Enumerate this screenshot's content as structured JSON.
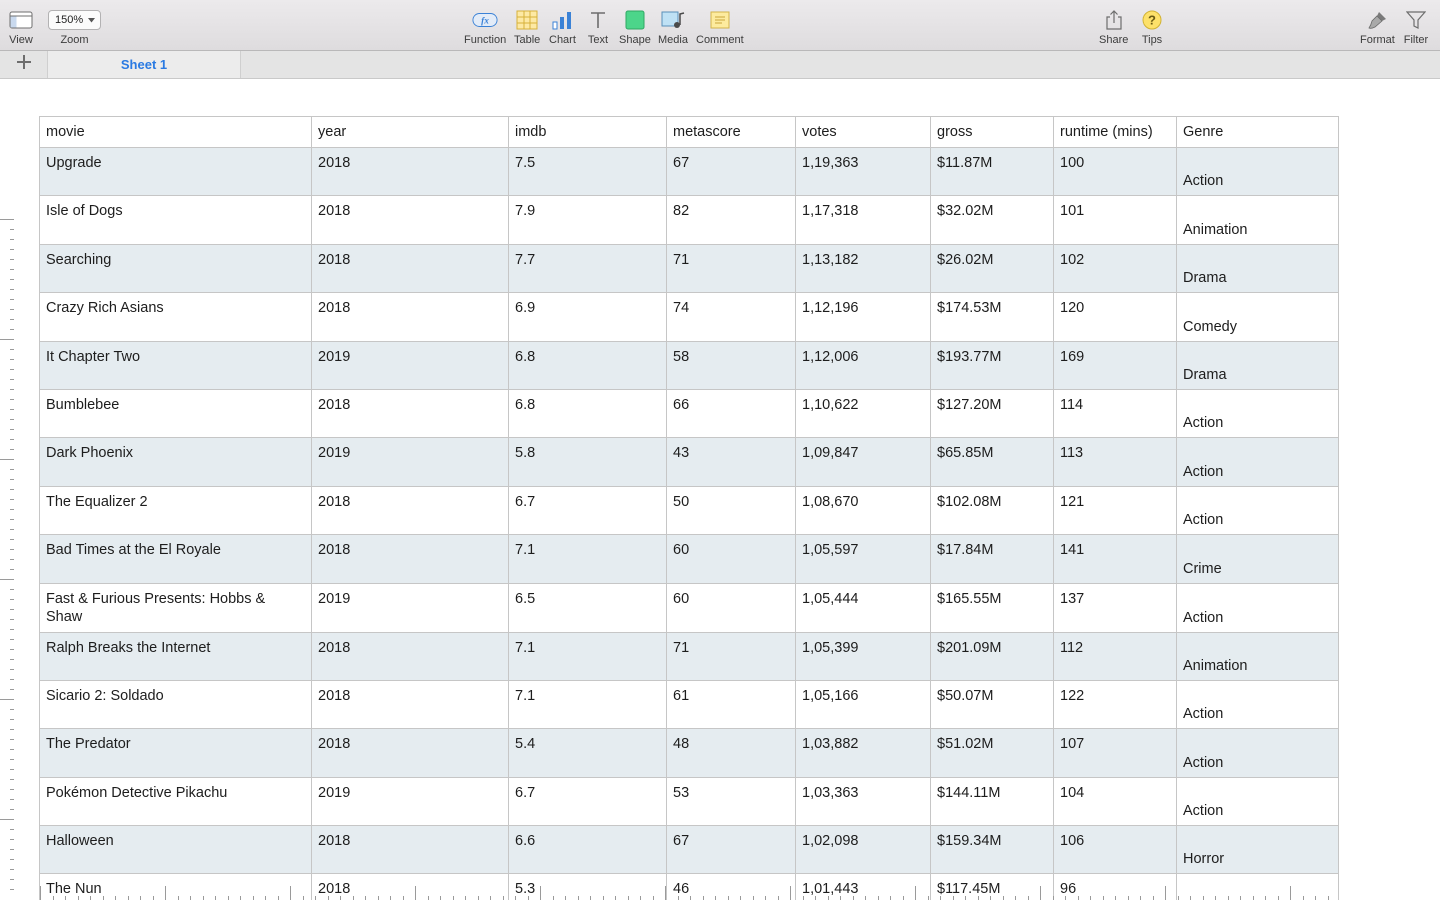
{
  "toolbar": {
    "left": [
      {
        "label": "View",
        "icon": "sidebar-view-icon"
      },
      {
        "label": "Zoom",
        "value": "150%",
        "icon": "chevron-down-icon"
      }
    ],
    "center": [
      {
        "label": "Function",
        "icon": "function-fx-icon"
      },
      {
        "label": "Table",
        "icon": "table-icon"
      },
      {
        "label": "Chart",
        "icon": "bar-chart-icon"
      },
      {
        "label": "Text",
        "icon": "text-icon"
      },
      {
        "label": "Shape",
        "icon": "shape-icon"
      },
      {
        "label": "Media",
        "icon": "media-icon"
      },
      {
        "label": "Comment",
        "icon": "comment-icon"
      }
    ],
    "right": [
      {
        "label": "Share",
        "icon": "share-icon"
      },
      {
        "label": "Tips",
        "icon": "tips-question-icon"
      }
    ],
    "far_right": [
      {
        "label": "Format",
        "icon": "format-brush-icon"
      },
      {
        "label": "Filter",
        "icon": "filter-funnel-icon"
      }
    ]
  },
  "sheets": {
    "add_icon": "plus-icon",
    "tabs": [
      "Sheet 1"
    ],
    "active": "Sheet 1",
    "active_color": "#2a7ae2"
  },
  "table": {
    "columns": [
      "movie",
      "year",
      "imdb",
      "metascore",
      "votes",
      "gross",
      "runtime (mins)",
      "Genre"
    ],
    "rows": [
      [
        "Upgrade",
        "2018",
        "7.5",
        "67",
        "1,19,363",
        "$11.87M",
        "100",
        "Action"
      ],
      [
        "Isle of Dogs",
        "2018",
        "7.9",
        "82",
        "1,17,318",
        "$32.02M",
        "101",
        "Animation"
      ],
      [
        "Searching",
        "2018",
        "7.7",
        "71",
        "1,13,182",
        "$26.02M",
        "102",
        "Drama"
      ],
      [
        "Crazy Rich Asians",
        "2018",
        "6.9",
        "74",
        "1,12,196",
        "$174.53M",
        "120",
        "Comedy"
      ],
      [
        "It Chapter Two",
        "2019",
        "6.8",
        "58",
        "1,12,006",
        "$193.77M",
        "169",
        "Drama"
      ],
      [
        "Bumblebee",
        "2018",
        "6.8",
        "66",
        "1,10,622",
        "$127.20M",
        "114",
        "Action"
      ],
      [
        "Dark Phoenix",
        "2019",
        "5.8",
        "43",
        "1,09,847",
        "$65.85M",
        "113",
        "Action"
      ],
      [
        "The Equalizer 2",
        "2018",
        "6.7",
        "50",
        "1,08,670",
        "$102.08M",
        "121",
        "Action"
      ],
      [
        "Bad Times at the El Royale",
        "2018",
        "7.1",
        "60",
        "1,05,597",
        "$17.84M",
        "141",
        "Crime"
      ],
      [
        "Fast & Furious Presents: Hobbs & Shaw",
        "2019",
        "6.5",
        "60",
        "1,05,444",
        "$165.55M",
        "137",
        "Action"
      ],
      [
        "Ralph Breaks the Internet",
        "2018",
        "7.1",
        "71",
        "1,05,399",
        "$201.09M",
        "112",
        "Animation"
      ],
      [
        "Sicario 2: Soldado",
        "2018",
        "7.1",
        "61",
        "1,05,166",
        "$50.07M",
        "122",
        "Action"
      ],
      [
        "The Predator",
        "2018",
        "5.4",
        "48",
        "1,03,882",
        "$51.02M",
        "107",
        "Action"
      ],
      [
        "Pokémon Detective Pikachu",
        "2019",
        "6.7",
        "53",
        "1,03,363",
        "$144.11M",
        "104",
        "Action"
      ],
      [
        "Halloween",
        "2018",
        "6.6",
        "67",
        "1,02,098",
        "$159.34M",
        "106",
        "Horror"
      ],
      [
        "The Nun",
        "2018",
        "5.3",
        "46",
        "1,01,443",
        "$117.45M",
        "96",
        ""
      ]
    ],
    "row_band_color": "#e5ecf0",
    "border_color": "#c6c6c6"
  }
}
